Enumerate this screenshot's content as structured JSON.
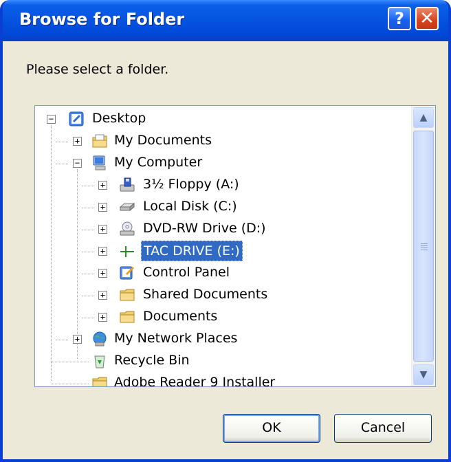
{
  "window": {
    "title": "Browse for Folder",
    "help_icon": "?",
    "close_icon": "✕"
  },
  "prompt": "Please select a folder.",
  "tree": {
    "items": [
      {
        "label": "Desktop",
        "icon": "desktop-icon",
        "expander": "−"
      },
      {
        "label": "My Documents",
        "icon": "my-documents-icon",
        "expander": "+"
      },
      {
        "label": "My Computer",
        "icon": "my-computer-icon",
        "expander": "−"
      },
      {
        "label": "3½ Floppy (A:)",
        "icon": "floppy-drive-icon",
        "expander": "+"
      },
      {
        "label": "Local Disk (C:)",
        "icon": "local-disk-icon",
        "expander": "+"
      },
      {
        "label": "DVD-RW Drive (D:)",
        "icon": "dvd-drive-icon",
        "expander": "+"
      },
      {
        "label": "TAC DRIVE (E:)",
        "icon": "removable-drive-icon",
        "expander": "+",
        "selected": true
      },
      {
        "label": "Control Panel",
        "icon": "control-panel-icon",
        "expander": "+"
      },
      {
        "label": "Shared Documents",
        "icon": "folder-icon",
        "expander": "+"
      },
      {
        "label": "Documents",
        "icon": "folder-icon",
        "expander": "+"
      },
      {
        "label": "My Network Places",
        "icon": "network-places-icon",
        "expander": "+"
      },
      {
        "label": "Recycle Bin",
        "icon": "recycle-bin-icon",
        "expander": ""
      },
      {
        "label": "Adobe Reader 9 Installer",
        "icon": "folder-icon",
        "expander": ""
      }
    ]
  },
  "scrollbar": {
    "up": "▲",
    "down": "▼"
  },
  "buttons": {
    "ok": "OK",
    "cancel": "Cancel"
  },
  "colors": {
    "title_bar": "#0553e0",
    "selection": "#316ac5",
    "face": "#ece9d8"
  }
}
